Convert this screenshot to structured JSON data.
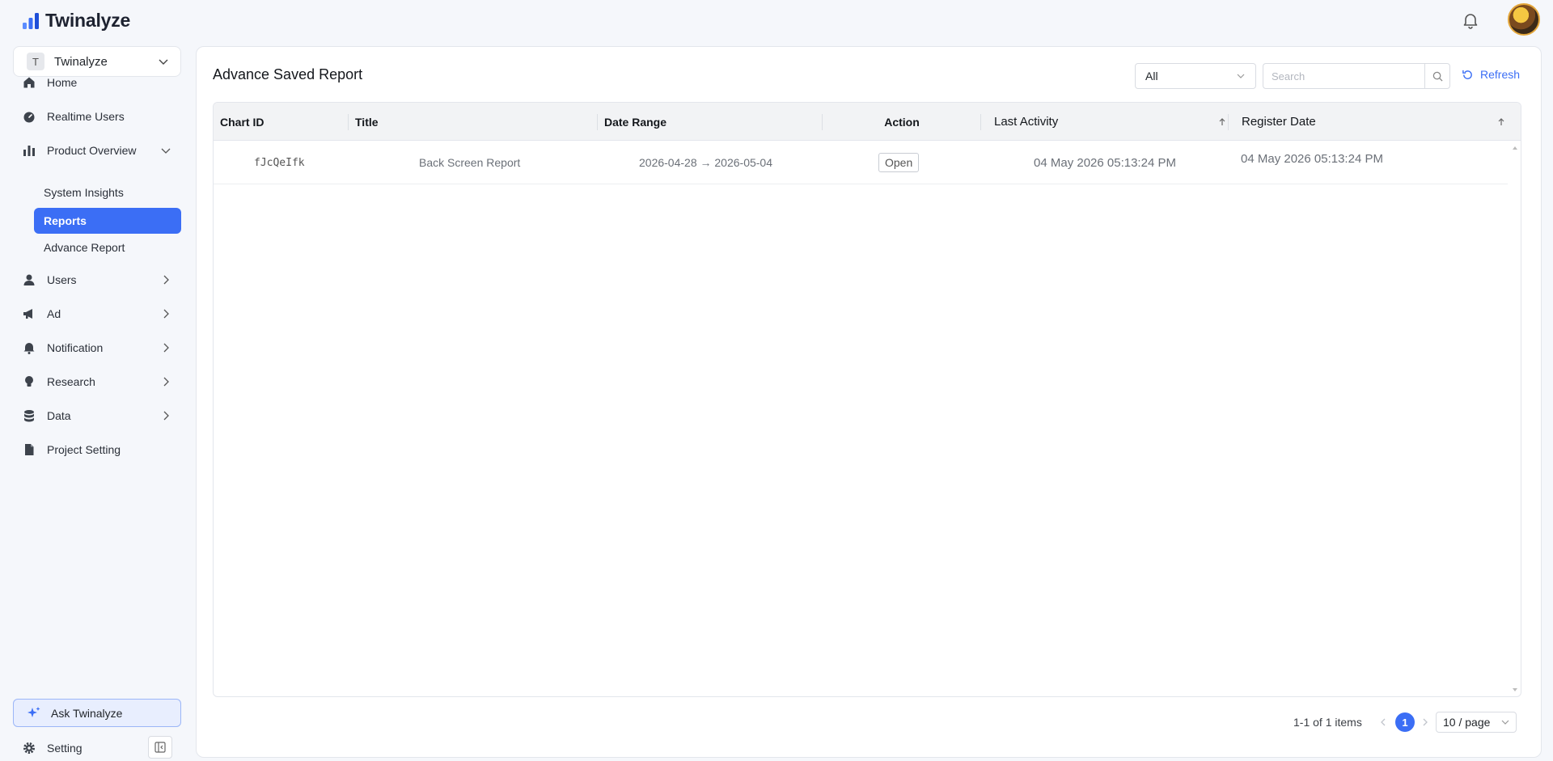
{
  "app": {
    "name": "Twinalyze"
  },
  "sidebar": {
    "project": {
      "badge": "T",
      "name": "Twinalyze"
    },
    "items": [
      {
        "label": "Home",
        "icon": "home-icon"
      },
      {
        "label": "Realtime Users",
        "icon": "gauge-icon"
      },
      {
        "label": "Product Overview",
        "icon": "bar-chart-icon",
        "expanded": true
      },
      {
        "label": "Users",
        "icon": "user-icon"
      },
      {
        "label": "Ad",
        "icon": "megaphone-icon"
      },
      {
        "label": "Notification",
        "icon": "bell-icon"
      },
      {
        "label": "Research",
        "icon": "bulb-icon"
      },
      {
        "label": "Data",
        "icon": "database-icon"
      },
      {
        "label": "Project Setting",
        "icon": "file-icon"
      }
    ],
    "subitems": [
      {
        "label": "System Insights"
      },
      {
        "label": "Reports",
        "active": true
      },
      {
        "label": "Advance Report"
      }
    ],
    "ask": "Ask Twinalyze",
    "setting": "Setting"
  },
  "main": {
    "title": "Advance Saved Report",
    "filter": {
      "value": "All"
    },
    "search": {
      "placeholder": "Search"
    },
    "refresh": "Refresh",
    "columns": {
      "chart_id": "Chart ID",
      "title": "Title",
      "date_range": "Date Range",
      "action": "Action",
      "last_activity": "Last Activity",
      "register_date": "Register Date"
    },
    "rows": [
      {
        "chart_id": "fJcQeIfk",
        "title": "Back Screen Report",
        "date_range": "2026-04-28 → 2026-05-04",
        "action": "Open",
        "last_activity": "04 May 2026 05:13:24 PM",
        "register_date": "04 May 2026 05:13:24 PM"
      }
    ],
    "pagination": {
      "summary": "1-1 of 1 items",
      "current_page": "1",
      "page_size": "10 / page"
    }
  },
  "colors": {
    "accent": "#3b6ef5",
    "active_bg": "#3b6ef5",
    "ask_bg": "#e8eefe"
  }
}
